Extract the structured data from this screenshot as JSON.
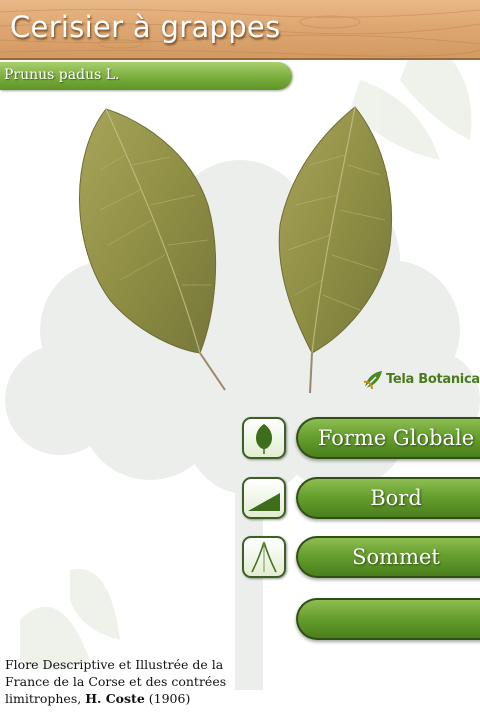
{
  "header": {
    "title": "Cerisier à grappes"
  },
  "species": {
    "latin_name": "Prunus padus L."
  },
  "logo": {
    "text": "Tela Botanica"
  },
  "menu": {
    "items": [
      {
        "label": "Forme Globale",
        "icon": "leaf-shape-icon"
      },
      {
        "label": "Bord",
        "icon": "leaf-edge-icon"
      },
      {
        "label": "Sommet",
        "icon": "leaf-tip-icon"
      },
      {
        "label": "",
        "icon": ""
      }
    ]
  },
  "citation": {
    "text": "Flore Descriptive et Illustrée de la France de la Corse et des contrées limitrophes,",
    "author": "H. Coste",
    "year": "(1906)"
  },
  "colors": {
    "header_wood": "#dea772",
    "accent_green": "#67a02f",
    "border_dark_green": "#2f4f17"
  }
}
